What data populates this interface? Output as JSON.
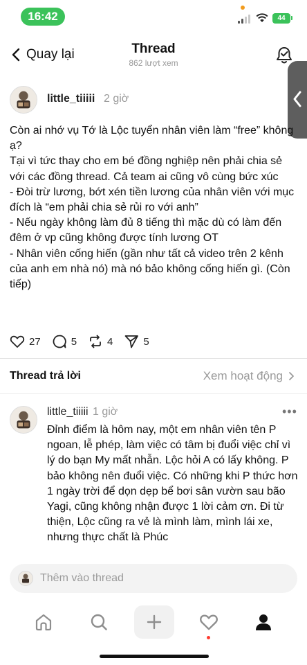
{
  "status_bar": {
    "time": "16:42",
    "battery": "44"
  },
  "nav": {
    "back_label": "Quay lại",
    "title": "Thread",
    "subtitle": "862 lượt xem"
  },
  "post": {
    "username": "little_tiiiii",
    "time": "2 giờ",
    "paragraphs": [
      "Còn ai nhớ vụ Tớ là Lộc tuyển nhân viên làm “free” không ạ?",
      "Tại vì tức thay cho em bé đồng nghiệp nên phải chia sẻ với các đồng thread. Cả team ai cũng vô cùng bức xúc",
      "- Đòi trừ lương, bớt xén tiền lương của nhân viên với mục đích là “em phải chia sẻ rủi ro với anh”",
      "- Nếu ngày không làm đủ 8 tiếng thì mặc dù có làm đến đêm ở vp cũng không được tính lương OT",
      "- Nhân viên cống hiến (gần như tất cả video trên 2 kênh của anh em nhà nó) mà nó bảo không cống hiến gì. (Còn tiếp)"
    ],
    "likes": "27",
    "comments": "5",
    "reposts": "4",
    "shares": "5"
  },
  "replies_section": {
    "title": "Thread trả lời",
    "activity_label": "Xem hoạt động"
  },
  "reply": {
    "username": "little_tiiiii",
    "time": "1 giờ",
    "more": "•••",
    "text": "Đỉnh điểm là hôm nay, một em nhân viên tên P ngoan, lễ phép, làm việc có tâm bị đuổi việc chỉ vì lý do bạn My mất nhẫn. Lộc hỏi A có lấy không. P bảo không nên đuổi việc. Có những khi P thức hơn 1 ngày trời để dọn dẹp bể bơi sân vườn sau bão Yagi, cũng không nhận được 1 lời cảm ơn. Đi từ thiện, Lộc cũng ra vẻ là mình làm, mình lái xe, nhưng thực chất là Phúc"
  },
  "compose": {
    "placeholder": "Thêm vào thread"
  },
  "tabbar": {
    "items": [
      "home-icon",
      "search-icon",
      "plus-icon",
      "heart-icon",
      "profile-icon"
    ]
  },
  "colors": {
    "status_green": "#3bc25a",
    "notification_red": "#ff3b30",
    "muted_text": "#9a9a9a"
  }
}
